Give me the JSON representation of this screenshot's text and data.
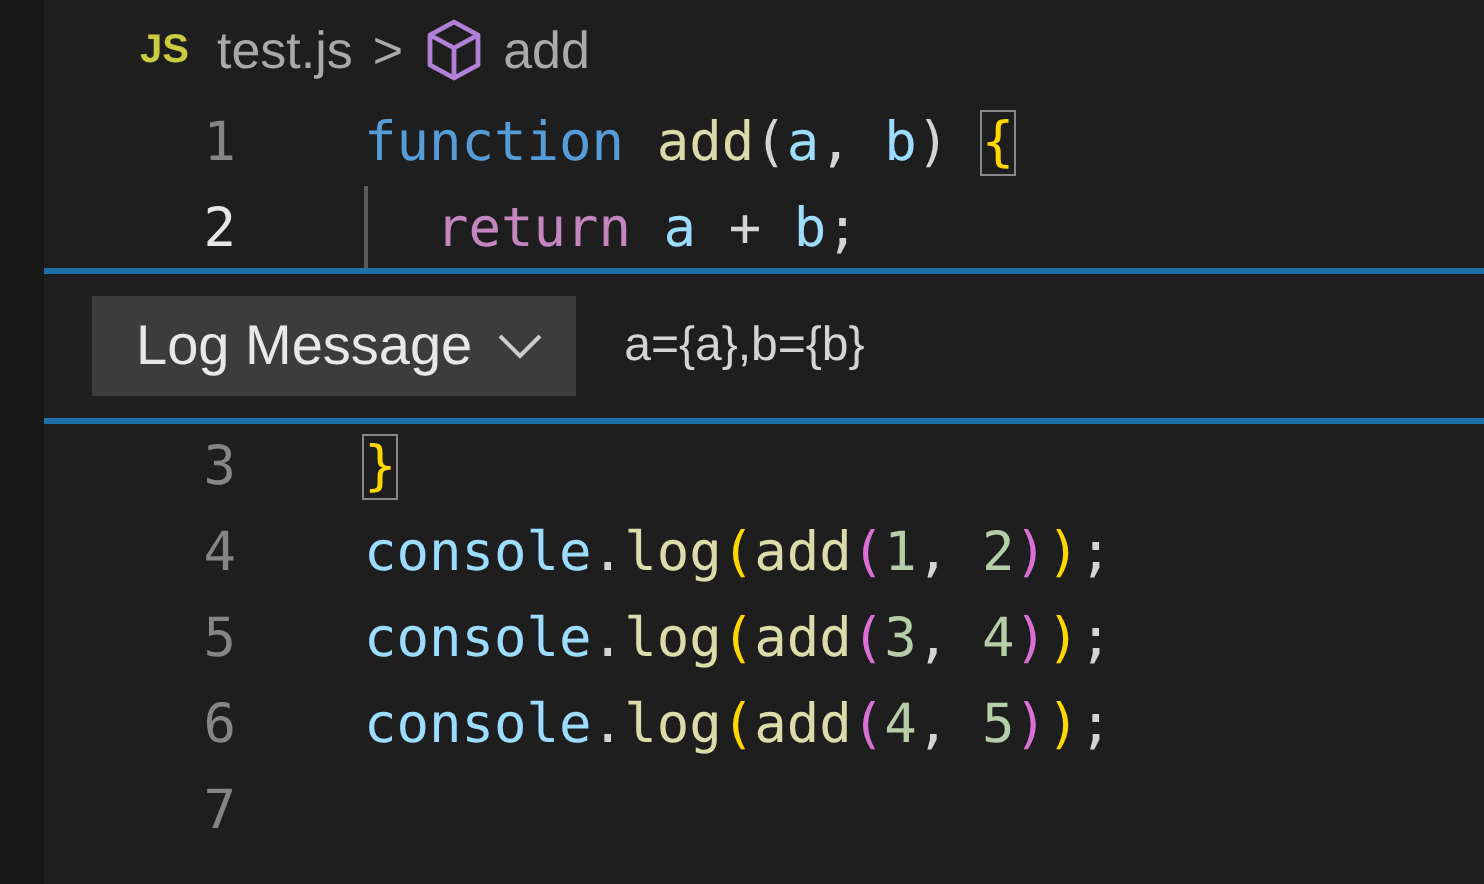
{
  "breadcrumb": {
    "file_badge": "JS",
    "file": "test.js",
    "separator": ">",
    "symbol": "add"
  },
  "lines_above": [
    {
      "number": "1",
      "current": false,
      "tokens": [
        {
          "text": "function ",
          "kind": "keyword"
        },
        {
          "text": "add",
          "kind": "func"
        },
        {
          "text": "(",
          "kind": "plain"
        },
        {
          "text": "a",
          "kind": "var"
        },
        {
          "text": ", ",
          "kind": "plain"
        },
        {
          "text": "b",
          "kind": "var"
        },
        {
          "text": ") ",
          "kind": "plain"
        },
        {
          "text": "{",
          "kind": "bracket1",
          "matched": true
        }
      ]
    },
    {
      "number": "2",
      "current": true,
      "indent_guide": true,
      "tokens": [
        {
          "text": "return",
          "kind": "control"
        },
        {
          "text": " a",
          "kind": "var"
        },
        {
          "text": " + ",
          "kind": "plain"
        },
        {
          "text": "b",
          "kind": "var"
        },
        {
          "text": ";",
          "kind": "plain"
        }
      ]
    }
  ],
  "log_panel": {
    "type_dropdown": "Log Message",
    "message": "a={a},b={b}"
  },
  "lines_below": [
    {
      "number": "3",
      "current": false,
      "tokens": [
        {
          "text": "}",
          "kind": "bracket1",
          "matched": true
        }
      ]
    },
    {
      "number": "4",
      "current": false,
      "tokens": [
        {
          "text": "console",
          "kind": "var"
        },
        {
          "text": ".",
          "kind": "plain"
        },
        {
          "text": "log",
          "kind": "func"
        },
        {
          "text": "(",
          "kind": "bracket1"
        },
        {
          "text": "add",
          "kind": "func"
        },
        {
          "text": "(",
          "kind": "bracket2"
        },
        {
          "text": "1",
          "kind": "number"
        },
        {
          "text": ", ",
          "kind": "plain"
        },
        {
          "text": "2",
          "kind": "number"
        },
        {
          "text": ")",
          "kind": "bracket2"
        },
        {
          "text": ")",
          "kind": "bracket1"
        },
        {
          "text": ";",
          "kind": "plain"
        }
      ]
    },
    {
      "number": "5",
      "current": false,
      "tokens": [
        {
          "text": "console",
          "kind": "var"
        },
        {
          "text": ".",
          "kind": "plain"
        },
        {
          "text": "log",
          "kind": "func"
        },
        {
          "text": "(",
          "kind": "bracket1"
        },
        {
          "text": "add",
          "kind": "func"
        },
        {
          "text": "(",
          "kind": "bracket2"
        },
        {
          "text": "3",
          "kind": "number"
        },
        {
          "text": ", ",
          "kind": "plain"
        },
        {
          "text": "4",
          "kind": "number"
        },
        {
          "text": ")",
          "kind": "bracket2"
        },
        {
          "text": ")",
          "kind": "bracket1"
        },
        {
          "text": ";",
          "kind": "plain"
        }
      ]
    },
    {
      "number": "6",
      "current": false,
      "tokens": [
        {
          "text": "console",
          "kind": "var"
        },
        {
          "text": ".",
          "kind": "plain"
        },
        {
          "text": "log",
          "kind": "func"
        },
        {
          "text": "(",
          "kind": "bracket1"
        },
        {
          "text": "add",
          "kind": "func"
        },
        {
          "text": "(",
          "kind": "bracket2"
        },
        {
          "text": "4",
          "kind": "number"
        },
        {
          "text": ", ",
          "kind": "plain"
        },
        {
          "text": "5",
          "kind": "number"
        },
        {
          "text": ")",
          "kind": "bracket2"
        },
        {
          "text": ")",
          "kind": "bracket1"
        },
        {
          "text": ";",
          "kind": "plain"
        }
      ]
    },
    {
      "number": "7",
      "current": false
    }
  ]
}
